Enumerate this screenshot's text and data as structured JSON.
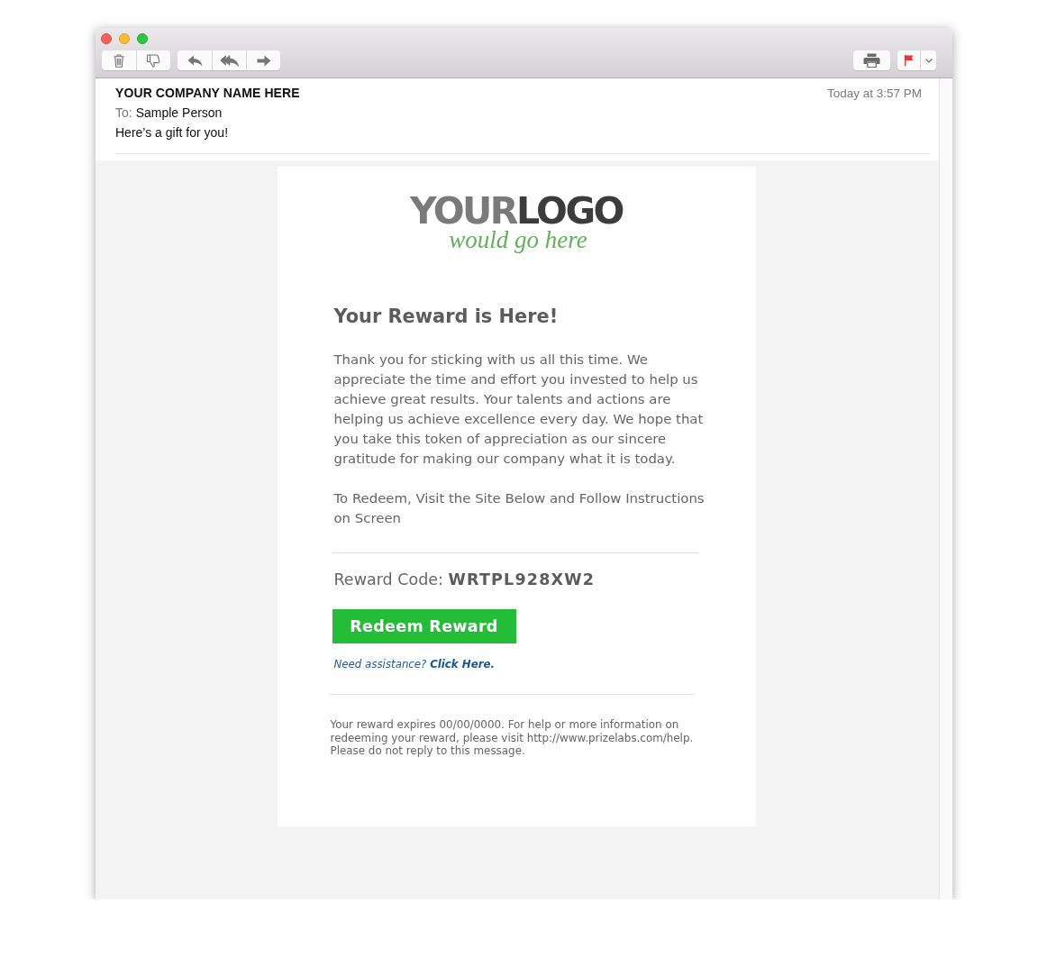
{
  "window": {
    "controls": [
      {
        "kind": "close"
      },
      {
        "kind": "minimize"
      },
      {
        "kind": "zoom"
      }
    ]
  },
  "toolbar": {
    "left_groups": [
      [
        {
          "kind": "trash"
        },
        {
          "kind": "junk"
        }
      ],
      [
        {
          "kind": "reply"
        },
        {
          "kind": "reply-all"
        },
        {
          "kind": "forward"
        }
      ]
    ],
    "right_groups": [
      [
        {
          "kind": "print"
        }
      ],
      [
        {
          "kind": "flag"
        },
        {
          "kind": "dropdown"
        }
      ]
    ]
  },
  "message_header": {
    "sender": "YOUR COMPANY NAME HERE",
    "to_label": "To:",
    "recipient": "Sample Person",
    "subject": "Here’s a gift for you!",
    "date": "Today at 3:57 PM"
  },
  "email": {
    "logo": {
      "wordmark": [
        {
          "text": "YOUR",
          "color": "#7a7a7a"
        },
        {
          "text": "LOGO",
          "color": "#3c3c3c"
        }
      ],
      "tagline": "would go here"
    },
    "heading": "Your Reward is Here!",
    "paragraphs": [
      "Thank you for sticking with us all this time. We appreciate the time and effort you invested to help us achieve great results. Your talents and actions are helping us achieve excellence every day. We hope that you take this token of appreciation as our sincere gratitude for making our company what it is today.",
      "To Redeem, Visit the Site Below and Follow Instructions on Screen"
    ],
    "reward_code": "Reward Code: **WRTPL928XW2**",
    "button": "Redeem Reward",
    "assistance": "Need assistance?",
    "assistance_link": "Click Here.",
    "footer": "Your reward expires 00/00/0000. For help or more information on redeeming your reward, please visit http://www.prizelabs.com/help. Please do not reply to this message."
  }
}
